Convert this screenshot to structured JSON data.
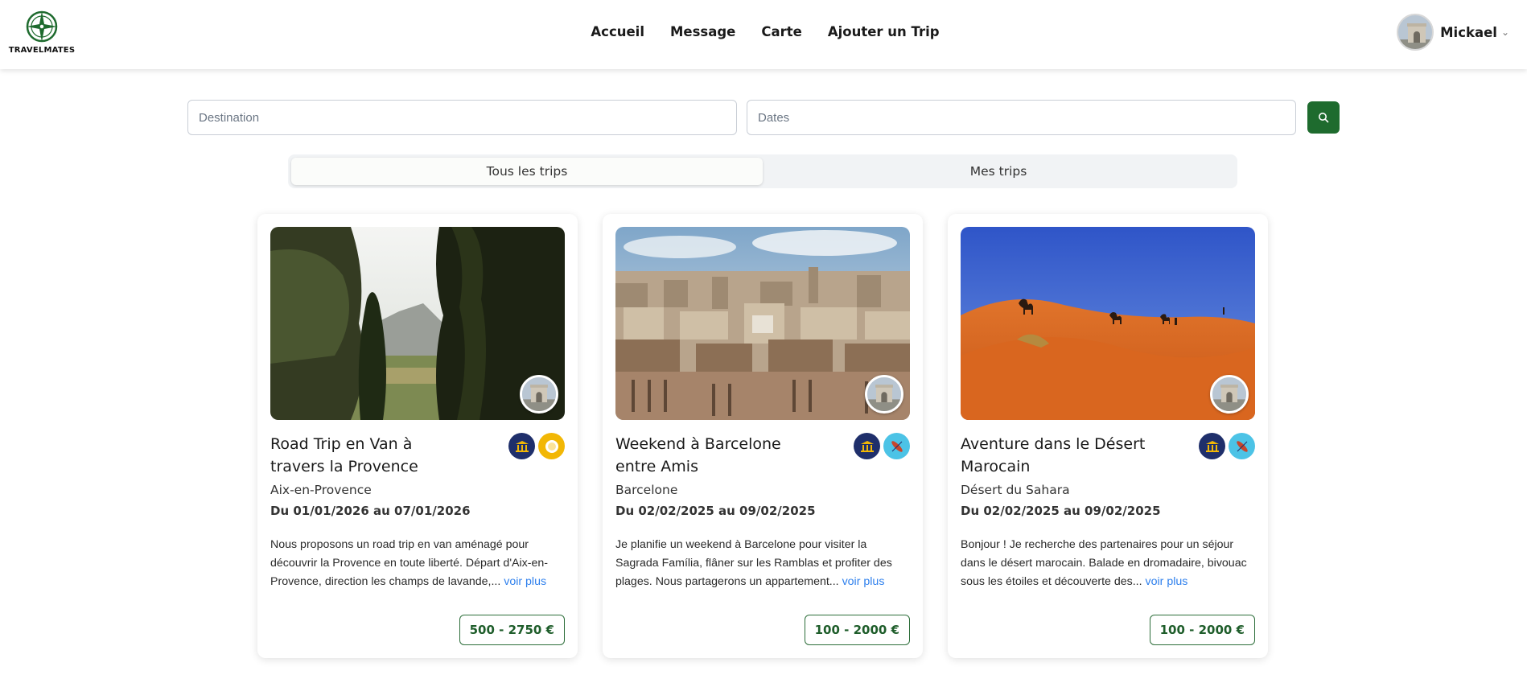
{
  "header": {
    "logo_text": "TRAVELMATES",
    "nav": [
      "Accueil",
      "Message",
      "Carte",
      "Ajouter un Trip"
    ],
    "user_name": "Mickael"
  },
  "search": {
    "destination_placeholder": "Destination",
    "dates_placeholder": "Dates"
  },
  "tabs": [
    {
      "label": "Tous les trips",
      "active": true
    },
    {
      "label": "Mes trips",
      "active": false
    }
  ],
  "cards": [
    {
      "title": "Road Trip en Van à travers la Provence",
      "location": "Aix-en-Provence",
      "dates": "Du 01/01/2026 au 07/01/2026",
      "description": "Nous proposons un road trip en van aménagé pour découvrir la Provence en toute liberté. Départ d'Aix-en-Provence, direction les champs de lavande,...",
      "more": "voir plus",
      "price": "500 - 2750 €",
      "badges": [
        "museum-icon",
        "food-icon"
      ]
    },
    {
      "title": "Weekend à Barcelone entre Amis",
      "location": "Barcelone",
      "dates": "Du 02/02/2025 au 09/02/2025",
      "description": "Je planifie un weekend à Barcelone pour visiter la Sagrada Família, flâner sur les Ramblas et profiter des plages. Nous partagerons un appartement...",
      "more": "voir plus",
      "price": "100 - 2000 €",
      "badges": [
        "museum-icon",
        "surf-icon"
      ]
    },
    {
      "title": "Aventure dans le Désert Marocain",
      "location": "Désert du Sahara",
      "dates": "Du 02/02/2025 au 09/02/2025",
      "description": "Bonjour ! Je recherche des partenaires pour un séjour dans le désert marocain. Balade en dromadaire, bivouac sous les étoiles et découverte des...",
      "more": "voir plus",
      "price": "100 - 2000 €",
      "badges": [
        "museum-icon",
        "surf-icon"
      ]
    }
  ],
  "colors": {
    "brand_green": "#1e6b2e",
    "link_blue": "#2f80ed",
    "museum_badge": "#1f2f6b",
    "food_badge": "#f2b705",
    "surf_badge": "#4cc3e6"
  }
}
